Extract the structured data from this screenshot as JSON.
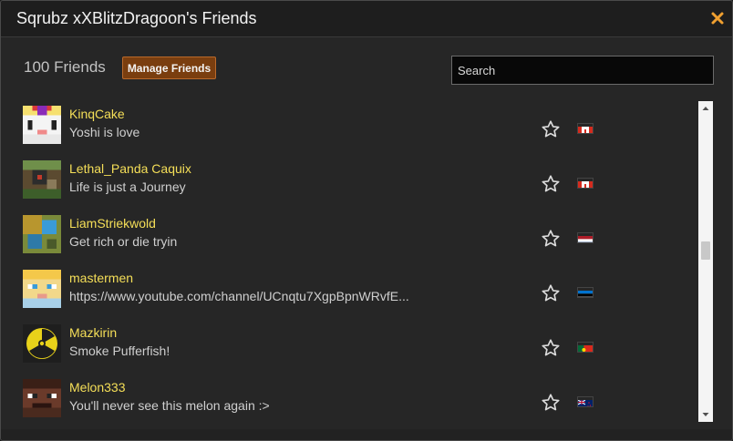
{
  "dialog": {
    "title": "Sqrubz xXBlitzDragoon's Friends",
    "close_icon": "close-icon",
    "accent_color": "#f0a030"
  },
  "toolbar": {
    "friend_count": "100 Friends",
    "manage_label": "Manage Friends",
    "manage_color": "#7a3e0f"
  },
  "search": {
    "placeholder": "Search",
    "value": ""
  },
  "friends": [
    {
      "name": "KinqCake",
      "status": "Yoshi is love",
      "flag": "canada"
    },
    {
      "name": "Lethal_Panda Caquix",
      "status": "Life is just a Journey",
      "flag": "canada"
    },
    {
      "name": "LiamStriekwold",
      "status": "Get rich or die tryin",
      "flag": "netherlands"
    },
    {
      "name": "mastermen",
      "status": "https://www.youtube.com/channel/UCnqtu7XgpBpnWRvfE...",
      "flag": "estonia"
    },
    {
      "name": "Mazkirin",
      "status": "Smoke Pufferfish!",
      "flag": "portugal"
    },
    {
      "name": "Melon333",
      "status": "You'll never see this melon again :>",
      "flag": "new-zealand"
    }
  ],
  "colors": {
    "name": "#f5df58",
    "status": "#cfcfcf",
    "background": "#262626"
  }
}
